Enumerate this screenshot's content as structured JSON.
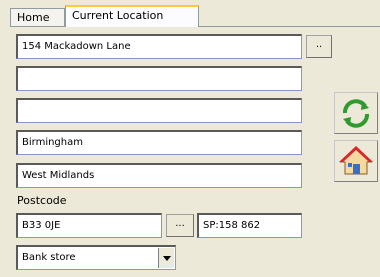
{
  "tabs": [
    {
      "label": "Home"
    },
    {
      "label": "Current Location"
    }
  ],
  "address": {
    "line1": "154 Mackadown Lane",
    "line2": "",
    "line3": "",
    "city": "Birmingham",
    "county": "West Midlands"
  },
  "postcode_label": "Postcode",
  "postcode_value": "B33 0JE",
  "lookup_button": "...",
  "line1_button": "..",
  "grid_ref": "SP:158 862",
  "location_type": "Bank store",
  "colors": {
    "background": "#ece9d8",
    "refresh_green": "#2f9b2f",
    "home_red": "#d8262a"
  }
}
